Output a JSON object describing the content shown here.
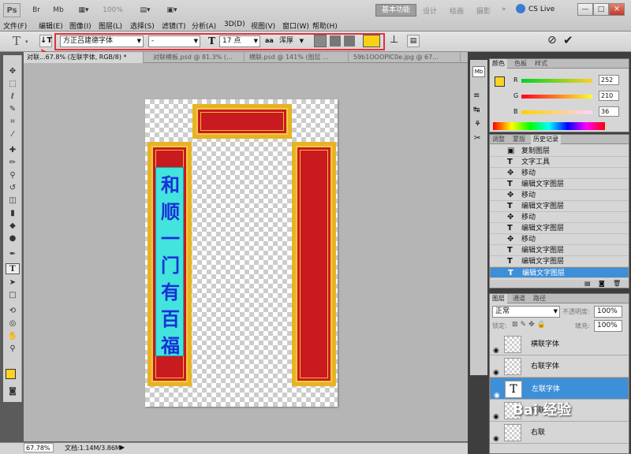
{
  "app": {
    "logo": "Ps"
  },
  "titlebar": {
    "zoom_value": "100%",
    "workspaces": [
      "基本功能",
      "设计",
      "绘画",
      "摄影"
    ],
    "cs_live": "CS Live",
    "window_buttons": [
      "—",
      "□",
      "✕"
    ]
  },
  "menu": [
    "文件(F)",
    "编辑(E)",
    "图像(I)",
    "图层(L)",
    "选择(S)",
    "滤镜(T)",
    "分析(A)",
    "3D(D)",
    "视图(V)",
    "窗口(W)",
    "帮助(H)"
  ],
  "options": {
    "tool_glyph": "T",
    "font_family": "方正吕建德字体",
    "font_style": "-",
    "font_size": "17 点",
    "aa_label": "aa",
    "aa_mode": "浑厚",
    "text_color": "#f7d117",
    "highlight_color": "#e4313b"
  },
  "doc_tabs": [
    "对联...67.8% (左联字体, RGB/8) *",
    "对联模板.psd @ 81.3% (...",
    "横联.psd @ 141% (图层 ...",
    "59b1OOOPIC0e.jpg @ 67..."
  ],
  "canvas": {
    "couplet_chars": [
      "和",
      "顺",
      "一",
      "门",
      "有",
      "百",
      "福"
    ]
  },
  "status": {
    "zoom": "67.78%",
    "doc_size": "文档:1.14M/3.86M"
  },
  "color_panel": {
    "tabs": [
      "颜色",
      "色板",
      "样式"
    ],
    "channels": [
      {
        "label": "R",
        "value": "252"
      },
      {
        "label": "G",
        "value": "210"
      },
      {
        "label": "B",
        "value": "36"
      }
    ],
    "fg_color": "#fcd224"
  },
  "history_panel": {
    "tabs": [
      "调整",
      "蒙版",
      "历史记录"
    ],
    "items": [
      "复制图层",
      "文字工具",
      "移动",
      "编辑文字图层",
      "移动",
      "编辑文字图层",
      "移动",
      "编辑文字图层",
      "移动",
      "编辑文字图层",
      "编辑文字图层",
      "编辑文字图层"
    ]
  },
  "layers_panel": {
    "tabs": [
      "图层",
      "通道",
      "路径"
    ],
    "blend_mode": "正常",
    "opacity_label": "不透明度:",
    "opacity": "100%",
    "lock_label": "锁定:",
    "fill_label": "填充:",
    "fill": "100%",
    "layers": [
      "横联字体",
      "右联字体",
      "左联字体",
      "横联",
      "右联"
    ]
  },
  "watermark": "Bai 经验"
}
